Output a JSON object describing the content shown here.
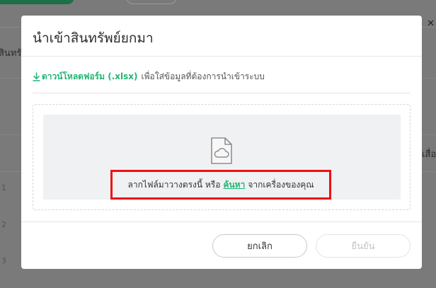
{
  "background": {
    "side_text_left": "สินทรั",
    "side_text_right": "เสื่อ",
    "row_numbers": [
      "1",
      "2",
      "3"
    ]
  },
  "modal": {
    "title": "นำเข้าสินทรัพย์ยกมา",
    "download_link_label": "ดาวน์โหลดฟอร์ม (.xlsx)",
    "download_description": "เพื่อใส่ข้อมูลที่ต้องการนำเข้าระบบ",
    "dropzone": {
      "text_before": "ลากไฟล์มาวางตรงนี้ หรือ",
      "browse_label": "ค้นหา",
      "text_after": "จากเครื่องของคุณ",
      "icon": "file-cloud-icon"
    },
    "cancel_label": "ยกเลิก",
    "confirm_label": "ยืนยัน"
  },
  "colors": {
    "accent": "#22b573",
    "highlight_border": "#ee1111",
    "overlay": "#7a7a7a"
  }
}
